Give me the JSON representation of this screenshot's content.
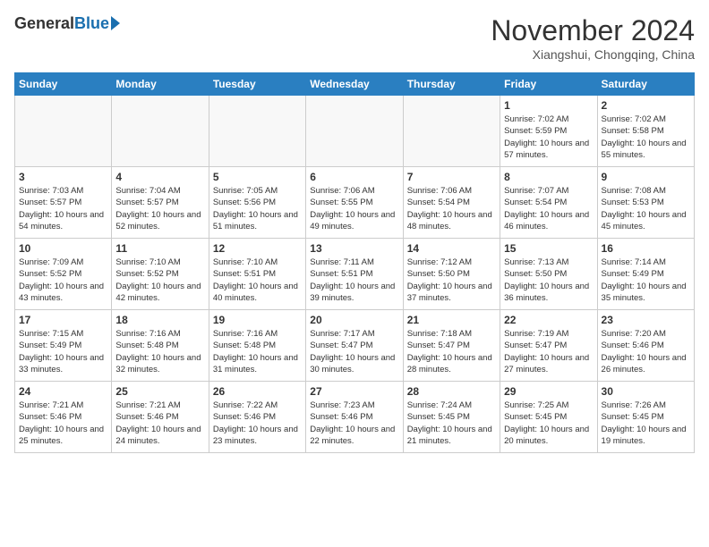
{
  "header": {
    "logo_general": "General",
    "logo_blue": "Blue",
    "month": "November 2024",
    "location": "Xiangshui, Chongqing, China"
  },
  "days_of_week": [
    "Sunday",
    "Monday",
    "Tuesday",
    "Wednesday",
    "Thursday",
    "Friday",
    "Saturday"
  ],
  "weeks": [
    [
      {
        "day": "",
        "info": ""
      },
      {
        "day": "",
        "info": ""
      },
      {
        "day": "",
        "info": ""
      },
      {
        "day": "",
        "info": ""
      },
      {
        "day": "",
        "info": ""
      },
      {
        "day": "1",
        "info": "Sunrise: 7:02 AM\nSunset: 5:59 PM\nDaylight: 10 hours and 57 minutes."
      },
      {
        "day": "2",
        "info": "Sunrise: 7:02 AM\nSunset: 5:58 PM\nDaylight: 10 hours and 55 minutes."
      }
    ],
    [
      {
        "day": "3",
        "info": "Sunrise: 7:03 AM\nSunset: 5:57 PM\nDaylight: 10 hours and 54 minutes."
      },
      {
        "day": "4",
        "info": "Sunrise: 7:04 AM\nSunset: 5:57 PM\nDaylight: 10 hours and 52 minutes."
      },
      {
        "day": "5",
        "info": "Sunrise: 7:05 AM\nSunset: 5:56 PM\nDaylight: 10 hours and 51 minutes."
      },
      {
        "day": "6",
        "info": "Sunrise: 7:06 AM\nSunset: 5:55 PM\nDaylight: 10 hours and 49 minutes."
      },
      {
        "day": "7",
        "info": "Sunrise: 7:06 AM\nSunset: 5:54 PM\nDaylight: 10 hours and 48 minutes."
      },
      {
        "day": "8",
        "info": "Sunrise: 7:07 AM\nSunset: 5:54 PM\nDaylight: 10 hours and 46 minutes."
      },
      {
        "day": "9",
        "info": "Sunrise: 7:08 AM\nSunset: 5:53 PM\nDaylight: 10 hours and 45 minutes."
      }
    ],
    [
      {
        "day": "10",
        "info": "Sunrise: 7:09 AM\nSunset: 5:52 PM\nDaylight: 10 hours and 43 minutes."
      },
      {
        "day": "11",
        "info": "Sunrise: 7:10 AM\nSunset: 5:52 PM\nDaylight: 10 hours and 42 minutes."
      },
      {
        "day": "12",
        "info": "Sunrise: 7:10 AM\nSunset: 5:51 PM\nDaylight: 10 hours and 40 minutes."
      },
      {
        "day": "13",
        "info": "Sunrise: 7:11 AM\nSunset: 5:51 PM\nDaylight: 10 hours and 39 minutes."
      },
      {
        "day": "14",
        "info": "Sunrise: 7:12 AM\nSunset: 5:50 PM\nDaylight: 10 hours and 37 minutes."
      },
      {
        "day": "15",
        "info": "Sunrise: 7:13 AM\nSunset: 5:50 PM\nDaylight: 10 hours and 36 minutes."
      },
      {
        "day": "16",
        "info": "Sunrise: 7:14 AM\nSunset: 5:49 PM\nDaylight: 10 hours and 35 minutes."
      }
    ],
    [
      {
        "day": "17",
        "info": "Sunrise: 7:15 AM\nSunset: 5:49 PM\nDaylight: 10 hours and 33 minutes."
      },
      {
        "day": "18",
        "info": "Sunrise: 7:16 AM\nSunset: 5:48 PM\nDaylight: 10 hours and 32 minutes."
      },
      {
        "day": "19",
        "info": "Sunrise: 7:16 AM\nSunset: 5:48 PM\nDaylight: 10 hours and 31 minutes."
      },
      {
        "day": "20",
        "info": "Sunrise: 7:17 AM\nSunset: 5:47 PM\nDaylight: 10 hours and 30 minutes."
      },
      {
        "day": "21",
        "info": "Sunrise: 7:18 AM\nSunset: 5:47 PM\nDaylight: 10 hours and 28 minutes."
      },
      {
        "day": "22",
        "info": "Sunrise: 7:19 AM\nSunset: 5:47 PM\nDaylight: 10 hours and 27 minutes."
      },
      {
        "day": "23",
        "info": "Sunrise: 7:20 AM\nSunset: 5:46 PM\nDaylight: 10 hours and 26 minutes."
      }
    ],
    [
      {
        "day": "24",
        "info": "Sunrise: 7:21 AM\nSunset: 5:46 PM\nDaylight: 10 hours and 25 minutes."
      },
      {
        "day": "25",
        "info": "Sunrise: 7:21 AM\nSunset: 5:46 PM\nDaylight: 10 hours and 24 minutes."
      },
      {
        "day": "26",
        "info": "Sunrise: 7:22 AM\nSunset: 5:46 PM\nDaylight: 10 hours and 23 minutes."
      },
      {
        "day": "27",
        "info": "Sunrise: 7:23 AM\nSunset: 5:46 PM\nDaylight: 10 hours and 22 minutes."
      },
      {
        "day": "28",
        "info": "Sunrise: 7:24 AM\nSunset: 5:45 PM\nDaylight: 10 hours and 21 minutes."
      },
      {
        "day": "29",
        "info": "Sunrise: 7:25 AM\nSunset: 5:45 PM\nDaylight: 10 hours and 20 minutes."
      },
      {
        "day": "30",
        "info": "Sunrise: 7:26 AM\nSunset: 5:45 PM\nDaylight: 10 hours and 19 minutes."
      }
    ]
  ]
}
